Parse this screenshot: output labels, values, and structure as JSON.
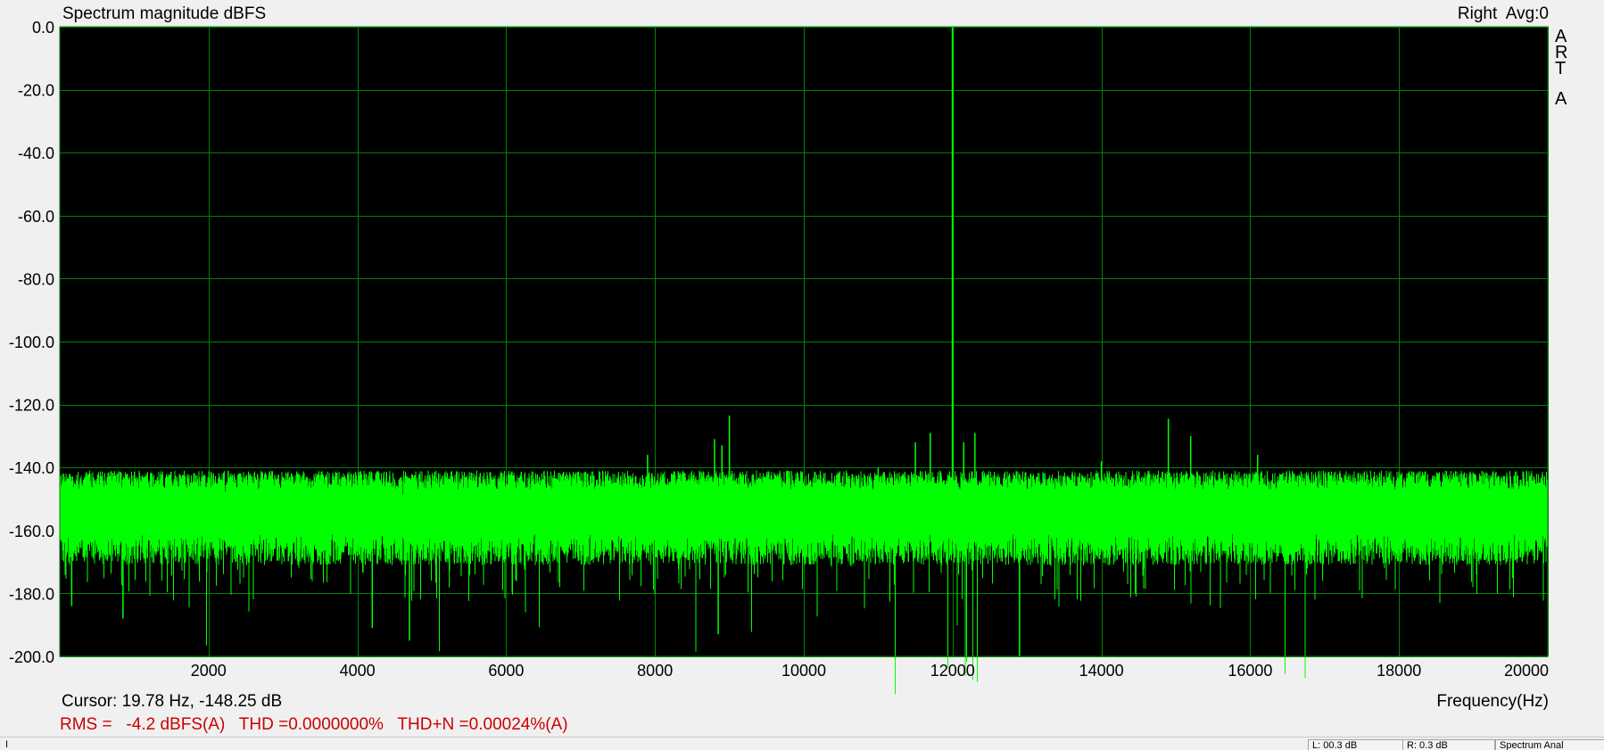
{
  "chart_data": {
    "type": "line",
    "title": "Spectrum magnitude dBFS",
    "channel_label": "Right  Avg:0",
    "brand_letters": [
      "A",
      "R",
      "T",
      "A"
    ],
    "xlabel": "Frequency(Hz)",
    "ylabel": "",
    "xlim": [
      0,
      20000
    ],
    "ylim": [
      -200,
      0
    ],
    "x_ticks": [
      2000,
      4000,
      6000,
      8000,
      10000,
      12000,
      14000,
      16000,
      18000,
      20000
    ],
    "x_tick_labels": [
      "2000",
      "4000",
      "6000",
      "8000",
      "10000",
      "12000",
      "14000",
      "16000",
      "18000",
      "20000"
    ],
    "y_ticks": [
      0,
      -20,
      -40,
      -60,
      -80,
      -100,
      -120,
      -140,
      -160,
      -180,
      -200
    ],
    "y_tick_labels": [
      "0.0",
      "-20.0",
      "-40.0",
      "-60.0",
      "-80.0",
      "-100.0",
      "-120.0",
      "-140.0",
      "-160.0",
      "-180.0",
      "-200.0"
    ],
    "grid": true,
    "colors": {
      "plot_bg": "#000000",
      "grid": "#008000",
      "trace": "#00ff00",
      "stats_text": "#cc0000"
    },
    "series": [
      {
        "noise_floor": {
          "upper_db": -144,
          "center_db": -152,
          "lower_db": -166,
          "deep_min_db": -195
        },
        "peaks": [
          {
            "x": 12000,
            "y": 0
          },
          {
            "x": 9000,
            "y": -123.5
          },
          {
            "x": 8800,
            "y": -131
          },
          {
            "x": 8900,
            "y": -133
          },
          {
            "x": 7900,
            "y": -136
          },
          {
            "x": 11700,
            "y": -129
          },
          {
            "x": 11500,
            "y": -132
          },
          {
            "x": 12150,
            "y": -132
          },
          {
            "x": 12300,
            "y": -129
          },
          {
            "x": 14900,
            "y": -124.5
          },
          {
            "x": 15200,
            "y": -130
          },
          {
            "x": 16100,
            "y": -136
          },
          {
            "x": 14000,
            "y": -138
          },
          {
            "x": 11000,
            "y": -140
          }
        ],
        "dips": [
          {
            "x": 12900,
            "y": -200
          },
          {
            "x": 4700,
            "y": -195
          },
          {
            "x": 8850,
            "y": -193
          },
          {
            "x": 4200,
            "y": -191
          },
          {
            "x": 850,
            "y": -188
          },
          {
            "x": 160,
            "y": -184
          }
        ]
      }
    ]
  },
  "readouts": {
    "cursor": "Cursor: 19.78 Hz, -148.25 dB",
    "stats": "RMS =   -4.2 dBFS(A)   THD =0.0000000%   THD+N =0.00024%(A)"
  },
  "statusbar": {
    "left": "I",
    "cells": [
      "L: 00.3 dB",
      "R: 0.3 dB",
      "Spectrum Anal"
    ]
  }
}
